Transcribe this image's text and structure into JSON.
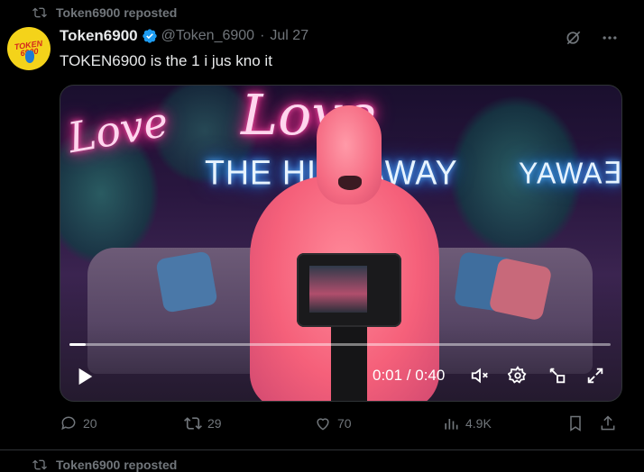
{
  "repost": {
    "text": "Token6900 reposted"
  },
  "tweet": {
    "author_name": "Token6900",
    "handle": "@Token_6900",
    "separator": "·",
    "date": "Jul 27",
    "text": "TOKEN6900 is the 1 i jus kno it",
    "avatar_text": "TOKEN 6900"
  },
  "media": {
    "neon_signs": {
      "left": "Love",
      "center_script": "Love",
      "center_text": "THE HIDEAWAY",
      "right_text": "YAWA∃"
    },
    "video": {
      "time_display": "0:01 / 0:40",
      "progress": 0.03
    }
  },
  "actions": {
    "replies": "20",
    "reposts": "29",
    "likes": "70",
    "views": "4.9K"
  },
  "next": {
    "repost_text": "Token6900 reposted"
  },
  "colors": {
    "background": "#000000",
    "muted": "#71767b",
    "verified": "#1d9bf0",
    "text": "#e7e9ea"
  }
}
